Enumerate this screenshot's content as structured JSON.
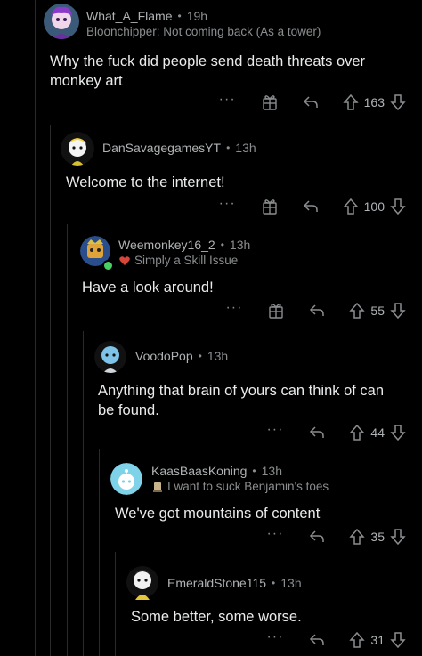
{
  "comments": [
    {
      "username": "What_A_Flame",
      "time": "19h",
      "flair": "Bloonchipper: Not coming back (As a tower)",
      "body": "Why the fuck did people send death threats over monkey art",
      "votes": "163",
      "more": "···",
      "has_award": true
    },
    {
      "username": "DanSavagegamesYT",
      "time": "13h",
      "flair": "",
      "body": "Welcome to the internet!",
      "votes": "100",
      "more": "···",
      "has_award": true
    },
    {
      "username": "Weemonkey16_2",
      "time": "13h",
      "flair": "Simply a Skill Issue",
      "body": "Have a look around!",
      "votes": "55",
      "more": "···",
      "has_award": true
    },
    {
      "username": "VoodoPop",
      "time": "13h",
      "flair": "",
      "body": "Anything that brain of yours can think of can be found.",
      "votes": "44",
      "more": "···",
      "has_award": false
    },
    {
      "username": "KaasBaasKoning",
      "time": "13h",
      "flair": "I want to suck Benjamin's toes",
      "body": "We've got mountains of content",
      "votes": "35",
      "more": "···",
      "has_award": false
    },
    {
      "username": "EmeraldStone115",
      "time": "13h",
      "flair": "",
      "body": "Some better, some worse.",
      "votes": "31",
      "more": "···",
      "has_award": false
    }
  ],
  "separator": "•",
  "icons": {
    "award": "award-icon",
    "reply": "reply-icon",
    "upvote": "upvote-icon",
    "downvote": "downvote-icon",
    "more": "more-icon"
  },
  "colors": {
    "background": "#000000",
    "text": "#eaebec",
    "meta": "#8a8d8f"
  }
}
